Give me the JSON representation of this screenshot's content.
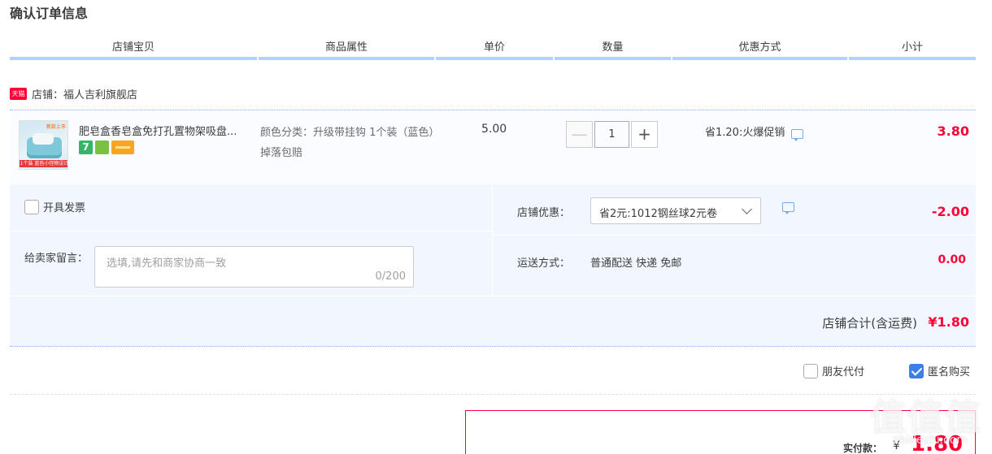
{
  "page": {
    "title": "确认订单信息"
  },
  "columns": [
    "店铺宝贝",
    "商品属性",
    "单价",
    "数量",
    "优惠方式",
    "小计"
  ],
  "shop": {
    "badge": "天猫",
    "label": "店铺：福人吉利旗舰店"
  },
  "item": {
    "thumb_tag_top": "新款上市",
    "thumb_tag_bottom": "1个装 蓝色小怪物设计",
    "name": "肥皂盒香皂盒免打孔置物架吸盘...",
    "service_icons": [
      {
        "name": "seven-day-return-icon",
        "glyph": "7"
      },
      {
        "name": "guarantee-icon",
        "glyph": ""
      },
      {
        "name": "credit-card-icon",
        "glyph": ""
      }
    ],
    "attribute": "颜色分类：升级带挂钩 1个装（蓝色）掉落包赔",
    "price": "5.00",
    "quantity": "1",
    "minus_label": "—",
    "plus_label": "+",
    "promotion": "省1.20:火爆促销",
    "subtotal": "3.80"
  },
  "options": {
    "invoice_label": "开具发票",
    "message_label": "给卖家留言：",
    "message_placeholder": "选填,请先和商家协商一致",
    "message_count": "0/200",
    "shop_discount_label": "店铺优惠：",
    "shop_discount_selected": "省2元:1012钢丝球2元卷",
    "shop_discount_amount": "-2.00",
    "shipping_label": "运送方式：",
    "shipping_value": "普通配送 快递 免邮",
    "shipping_amount": "0.00"
  },
  "total": {
    "label": "店铺合计(含运费)",
    "amount": "¥1.80"
  },
  "pay_options": {
    "friend_pay_label": "朋友代付",
    "friend_pay_checked": false,
    "anonymous_label": "匿名购买",
    "anonymous_checked": true
  },
  "final": {
    "label": "实付款：",
    "currency": "¥",
    "amount": "1.80"
  },
  "watermark": {
    "text": "值值值",
    "sub": "zhidezhi.com"
  },
  "colors": {
    "accent_red": "#ff0036",
    "header_blue": "#b2d1ff",
    "panel_bg": "#f2f7ff",
    "check_blue": "#3d7ee8"
  }
}
